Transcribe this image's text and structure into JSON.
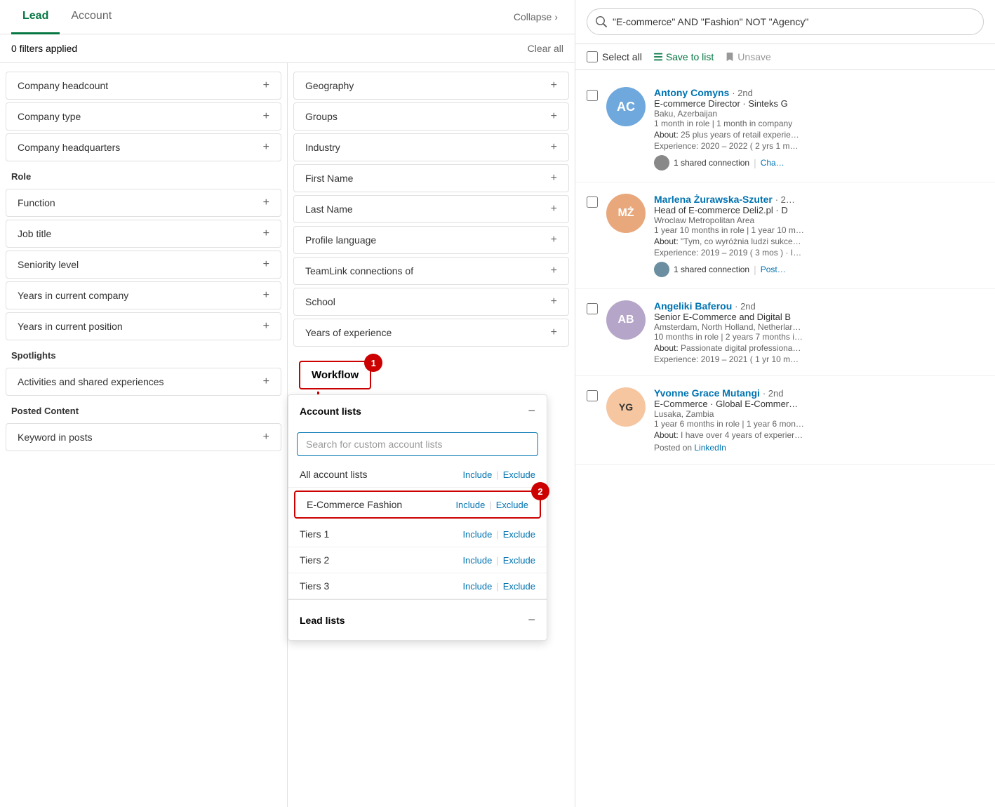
{
  "tabs": {
    "lead": "Lead",
    "account": "Account",
    "collapse": "Collapse"
  },
  "filter_bar": {
    "applied": "0 filters applied",
    "clear_all": "Clear all"
  },
  "left_col_filters": [
    {
      "label": "Company headcount",
      "section": null
    },
    {
      "label": "Company type",
      "section": null
    },
    {
      "label": "Company headquarters",
      "section": null
    },
    {
      "label": "Function",
      "section": "Role"
    },
    {
      "label": "Job title",
      "section": null
    },
    {
      "label": "Seniority level",
      "section": null
    },
    {
      "label": "Years in current company",
      "section": null
    },
    {
      "label": "Years in current position",
      "section": null
    },
    {
      "label": "Activities and shared experiences",
      "section": "Spotlights"
    },
    {
      "label": "Keyword in posts",
      "section": "Posted Content"
    }
  ],
  "right_col_filters": [
    {
      "label": "Geography"
    },
    {
      "label": "Groups"
    },
    {
      "label": "Industry"
    },
    {
      "label": "First Name"
    },
    {
      "label": "Last Name"
    },
    {
      "label": "Profile language"
    },
    {
      "label": "TeamLink connections of"
    },
    {
      "label": "School"
    },
    {
      "label": "Years of experience"
    }
  ],
  "workflow": {
    "label": "Workflow",
    "step": "1",
    "step2": "2"
  },
  "dropdown": {
    "account_lists_label": "Account lists",
    "search_placeholder": "Search for custom account lists",
    "all_account_lists": "All account lists",
    "items": [
      {
        "name": "E-Commerce Fashion",
        "highlighted": true
      },
      {
        "name": "Tiers 1"
      },
      {
        "name": "Tiers 2"
      },
      {
        "name": "Tiers 3"
      }
    ],
    "include_label": "Include",
    "exclude_label": "Exclude",
    "lead_lists_label": "Lead lists"
  },
  "search_bar": {
    "value": "\"E-commerce\" AND \"Fashion\" NOT \"Agency\""
  },
  "actions": {
    "select_all": "Select all",
    "save_to_list": "Save to list",
    "unsave": "Unsave"
  },
  "results": [
    {
      "name": "Antony Comyns",
      "degree": "· 2nd",
      "title": "E-commerce Director · Sinteks G",
      "location": "Baku, Azerbaijan",
      "tenure": "1 month in role | 1 month in company",
      "about": "25 plus years of retail experie…",
      "experience": "Experience: 2020 – 2022  ( 2 yrs 1 m…",
      "shared_conn": "1 shared connection",
      "action": "Cha…",
      "bg": "#b0c4de",
      "initials": "AC"
    },
    {
      "name": "Marlena Żurawska-Szuter",
      "degree": "· 2…",
      "title": "Head of E-commerce Deli2.pl · D",
      "location": "Wroclaw Metropolitan Area",
      "tenure": "1 year 10 months in role | 1 year 10 m…",
      "about": "\"Tym, co wyróżnia ludzi sukce…",
      "experience": "Experience: 2019 – 2019  ( 3 mos ) · I…",
      "shared_conn": "1 shared connection",
      "action": "Post…",
      "bg": "#e8a87c",
      "initials": "MŻ"
    },
    {
      "name": "Angeliki Baferou",
      "degree": "· 2nd",
      "title": "Senior E-Commerce and Digital B",
      "location": "Amsterdam, North Holland, Netherlar…",
      "tenure": "10 months in role | 2 years 7 months i…",
      "about": "Passionate digital professiona…",
      "experience": "Experience: 2019 – 2021  ( 1 yr 10 m…",
      "shared_conn": "",
      "action": "",
      "bg": "#c9b1d9",
      "initials": "AB"
    },
    {
      "name": "Yvonne Grace Mutangi",
      "degree": "· 2nd",
      "title": "E-Commerce · Global E-Commer…",
      "location": "Lusaka, Zambia",
      "tenure": "1 year 6 months in role | 1 year 6 mon…",
      "about": "I have over 4 years of experier…",
      "experience": "",
      "posted": "Posted on LinkedIn",
      "shared_conn": "",
      "action": "",
      "bg": "#f5c6a0",
      "initials": "YG"
    }
  ]
}
